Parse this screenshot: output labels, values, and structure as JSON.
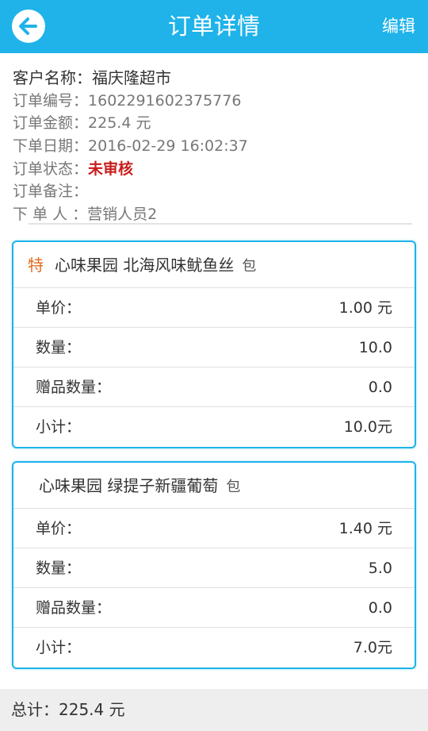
{
  "header": {
    "title": "订单详情",
    "edit_label": "编辑",
    "back_icon": "back-arrow-icon",
    "bg_color": "#1fb3ea"
  },
  "order": {
    "customer_label": "客户名称：",
    "customer_value": "福庆隆超市",
    "number_label": "订单编号：",
    "number_value": "1602291602375776",
    "amount_label": "订单金额：",
    "amount_value": "225.4  元",
    "date_label": "下单日期：",
    "date_value": "2016-02-29 16:02:37",
    "status_label": "订单状态：",
    "status_value": "未审核",
    "status_color": "#c81e1e",
    "note_label": "订单备注：",
    "note_value": "",
    "creator_label": "下 单 人 ：",
    "creator_value": "营销人员2"
  },
  "items": [
    {
      "special": "特",
      "name": "心味果园 北海风味鱿鱼丝",
      "unit": "包",
      "price_label": "单价：",
      "price_value": "1.00 元",
      "qty_label": "数量：",
      "qty_value": "10.0",
      "gift_label": "赠品数量：",
      "gift_value": "0.0",
      "subtotal_label": "小计：",
      "subtotal_value": "10.0元"
    },
    {
      "special": "",
      "name": "心味果园 绿提子新疆葡萄",
      "unit": "包",
      "price_label": "单价：",
      "price_value": "1.40 元",
      "qty_label": "数量：",
      "qty_value": "5.0",
      "gift_label": "赠品数量：",
      "gift_value": "0.0",
      "subtotal_label": "小计：",
      "subtotal_value": "7.0元"
    }
  ],
  "footer": {
    "total_label": "总计：",
    "total_value": "225.4  元"
  }
}
